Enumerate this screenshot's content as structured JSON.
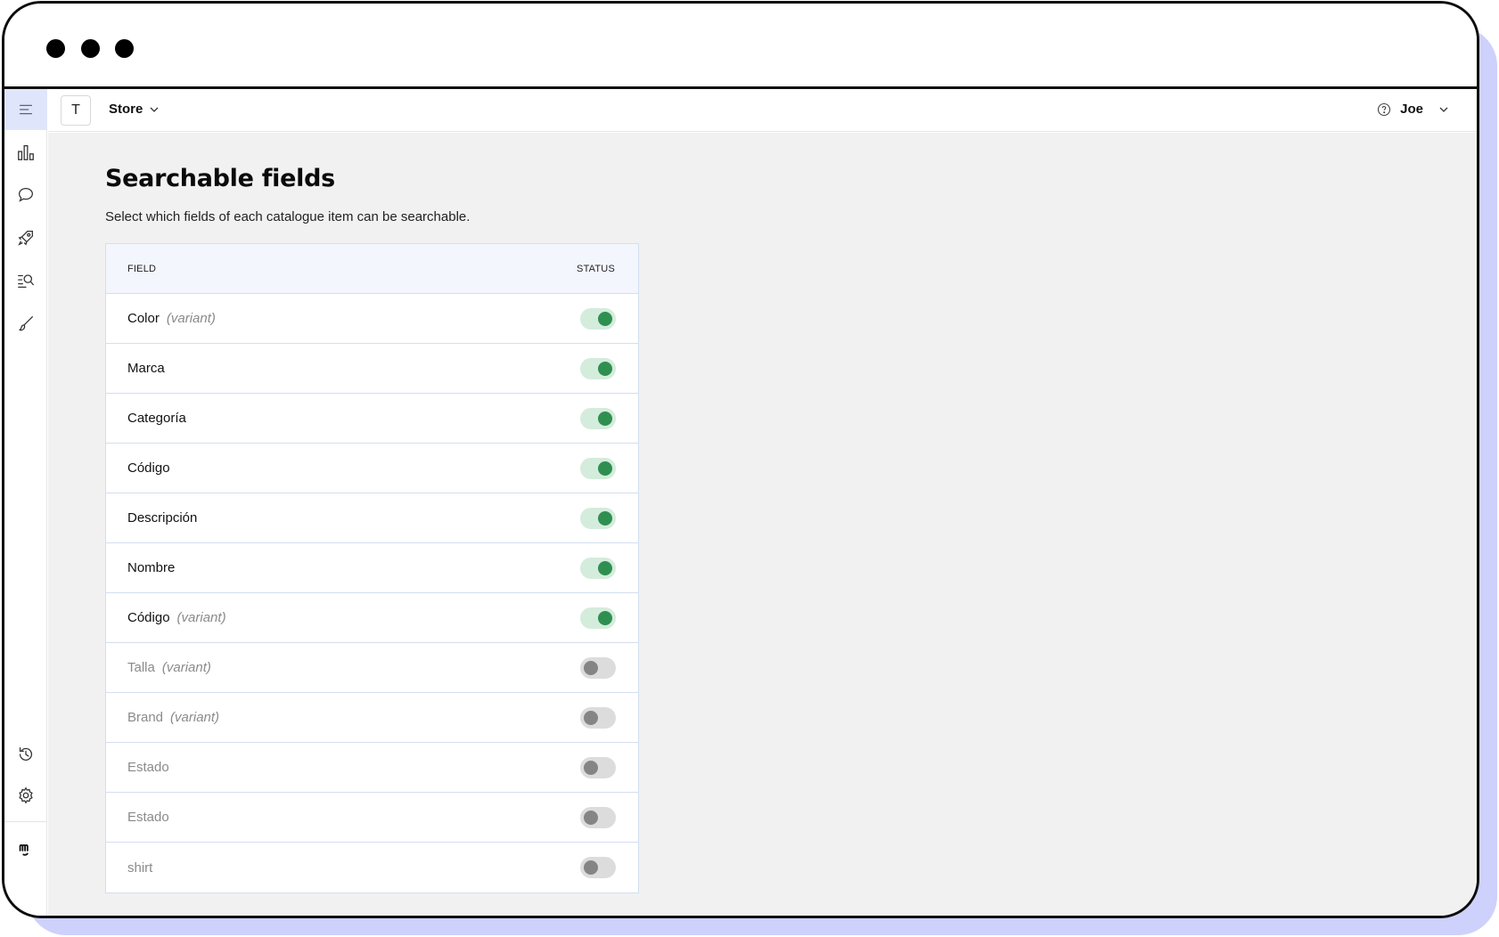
{
  "header": {
    "store_initial": "T",
    "store_name": "Store",
    "user_name": "Joe"
  },
  "sidebar": {
    "items": [
      {
        "icon": "menu-icon"
      },
      {
        "icon": "bar-chart-icon"
      },
      {
        "icon": "chat-bubble-icon"
      },
      {
        "icon": "rocket-icon"
      },
      {
        "icon": "search-list-icon"
      },
      {
        "icon": "brush-icon"
      }
    ],
    "bottom": [
      {
        "icon": "history-icon"
      },
      {
        "icon": "gear-icon"
      },
      {
        "icon": "brand-logo-icon"
      }
    ]
  },
  "page": {
    "title": "Searchable fields",
    "description": "Select which fields of each catalogue item can be searchable."
  },
  "table": {
    "headers": {
      "field": "FIELD",
      "status": "STATUS"
    },
    "variant_label": "(variant)",
    "rows": [
      {
        "name": "Color",
        "variant": true,
        "enabled": true
      },
      {
        "name": "Marca",
        "variant": false,
        "enabled": true
      },
      {
        "name": "Categoría",
        "variant": false,
        "enabled": true
      },
      {
        "name": "Código",
        "variant": false,
        "enabled": true
      },
      {
        "name": "Descripción",
        "variant": false,
        "enabled": true
      },
      {
        "name": "Nombre",
        "variant": false,
        "enabled": true
      },
      {
        "name": "Código",
        "variant": true,
        "enabled": true
      },
      {
        "name": "Talla",
        "variant": true,
        "enabled": false
      },
      {
        "name": "Brand",
        "variant": true,
        "enabled": false
      },
      {
        "name": "Estado",
        "variant": false,
        "enabled": false
      },
      {
        "name": "Estado",
        "variant": false,
        "enabled": false
      },
      {
        "name": "shirt",
        "variant": false,
        "enabled": false
      }
    ]
  },
  "colors": {
    "accent_bg": "#dfe6fb",
    "toggle_on": "#2f8f50",
    "toggle_off": "#858585",
    "frame_shadow": "#cdd1fb"
  }
}
